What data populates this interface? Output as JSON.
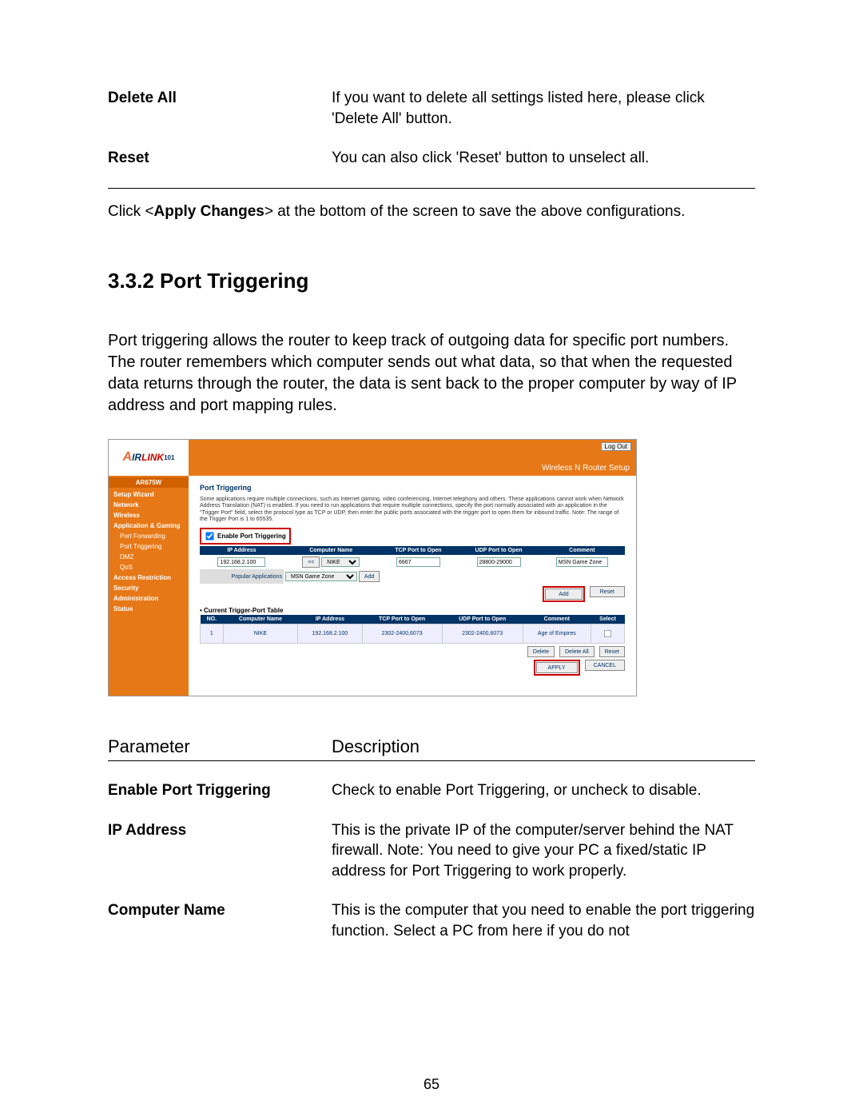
{
  "topParams": {
    "deleteAll": {
      "label": "Delete All",
      "desc": "If you want to delete all settings listed here, please click 'Delete All' button."
    },
    "reset": {
      "label": "Reset",
      "desc": "You can also click 'Reset' button to unselect all."
    }
  },
  "applyNote_pre": "Click <",
  "applyNote_bold": "Apply Changes",
  "applyNote_post": "> at the bottom of the screen to save the above configurations.",
  "section_number": "3.3.2 Port Triggering",
  "intro": "Port triggering allows the router to keep track of outgoing data for specific port numbers. The router remembers which computer sends out what data, so that when the requested data returns through the router, the data is sent back to the proper computer by way of IP address and port mapping rules.",
  "router": {
    "logo_a": "A",
    "logo_ir": "IR",
    "logo_link": "LINK",
    "logo_101": "101",
    "logout": "Log Out",
    "banner": "Wireless N Router Setup",
    "model": "AR675W",
    "nav": {
      "setup": "Setup Wizard",
      "network": "Network",
      "wireless": "Wireless",
      "appgaming": "Application & Gaming",
      "portfwd": "Port Forwarding",
      "porttrig": "Port Triggering",
      "dmz": "DMZ",
      "qos": "QoS",
      "access": "Access Restriction",
      "security": "Security",
      "admin": "Administration",
      "status": "Status"
    },
    "pt_title": "Port Triggering",
    "pt_desc": "Some applications require multiple connections, such as Internet gaming, video conferencing, Internet telephony and others. These applications cannot work when Network Address Translation (NAT) is enabled. If you need to run applications that require multiple connections, specify the port normally associated with an application in the \"Trigger Port\" field, select the protocol type as TCP or UDP, then enter the public ports associated with the trigger port to open them for inbound traffic. Note: The range of the Trigger Port is 1 to 65535.",
    "enable_label": "Enable Port Triggering",
    "ftbl": {
      "h_ip": "IP Address",
      "h_cn": "Computer Name",
      "h_tcp": "TCP Port to Open",
      "h_udp": "UDP Port to Open",
      "h_cmt": "Comment",
      "ip": "192.168.2.100",
      "cn_btn": "<<",
      "cn_sel": "NIKE",
      "tcp": "6667",
      "udp": "28800-29000",
      "cmt": "MSN Game Zone",
      "pop_label": "Popular Applications",
      "pop_sel": "MSN Game Zone",
      "add_small": "Add",
      "add": "Add",
      "reset": "Reset"
    },
    "ttbl": {
      "title": "• Current Trigger-Port Table",
      "h_no": "NO.",
      "h_cn": "Computer Name",
      "h_ip": "IP Address",
      "h_tcp": "TCP Port to Open",
      "h_udp": "UDP Port to Open",
      "h_cmt": "Comment",
      "h_sel": "Select",
      "r_no": "1",
      "r_cn": "NIKE",
      "r_ip": "192.168.2.100",
      "r_tcp": "2302-2400,6073",
      "r_udp": "2302-2400,6073",
      "r_cmt": "Age of Empires",
      "btn_delete": "Delete",
      "btn_deleteall": "Delete All",
      "btn_reset": "Reset",
      "btn_apply": "APPLY",
      "btn_cancel": "CANCEL"
    }
  },
  "paramHeader": {
    "param": "Parameter",
    "desc": "Description"
  },
  "bottomParams": {
    "enable": {
      "label": "Enable Port Triggering",
      "desc": "Check to enable Port Triggering, or uncheck to disable."
    },
    "ip": {
      "label": "IP Address",
      "desc": "This is the private IP of the computer/server behind the NAT firewall. Note: You need to give your PC a fixed/static IP address for Port Triggering to work properly."
    },
    "cn": {
      "label": "Computer Name",
      "desc": "This is the computer that you need to enable the port triggering function. Select a PC from here if you do not"
    }
  },
  "page_number": "65"
}
